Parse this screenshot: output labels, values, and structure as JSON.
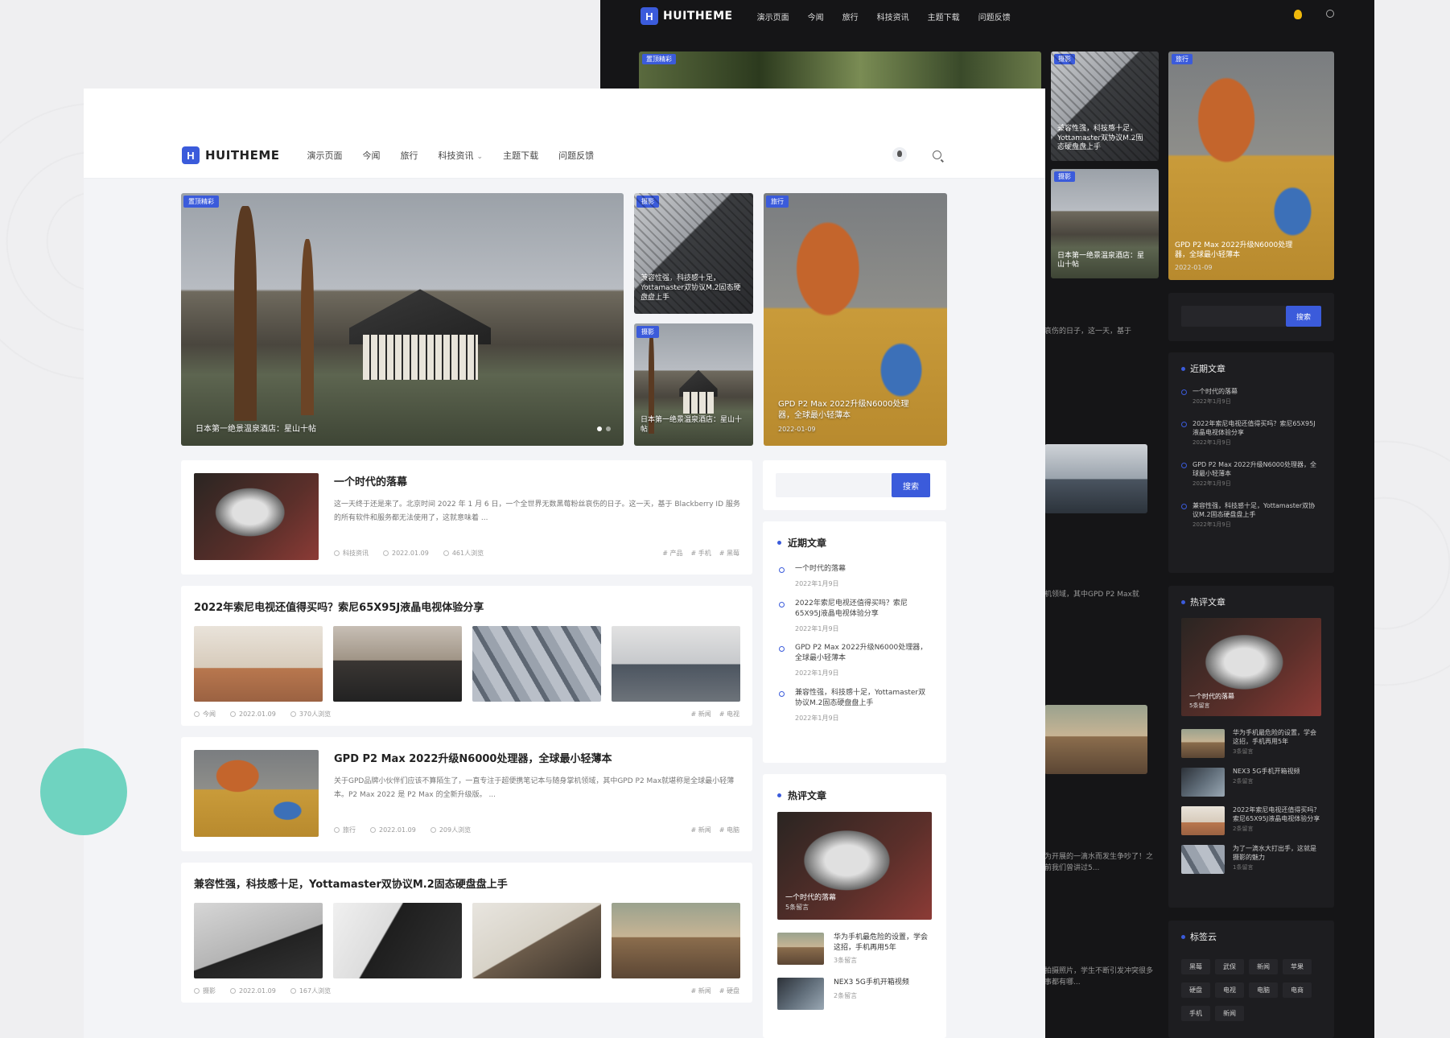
{
  "brand": {
    "name": "HUITHEME",
    "logo_letter": "H",
    "accent": "#3b5bdb"
  },
  "nav": {
    "items": [
      "演示页面",
      "今闻",
      "旅行",
      "科技资讯",
      "主题下载",
      "问题反馈"
    ]
  },
  "hero": {
    "main": {
      "tag": "置顶精彩",
      "caption": "日本第一绝景温泉酒店：星山十帖"
    },
    "small1": {
      "tag": "摄影",
      "caption": "兼容性强，科技感十足，Yottamaster双协议M.2固态硬盘盘上手"
    },
    "small2": {
      "tag": "摄影",
      "caption": "日本第一绝景温泉酒店：星山十帖"
    },
    "tall": {
      "tag": "旅行",
      "caption": "GPD P2 Max 2022升级N6000处理器，全球最小轻薄本",
      "date": "2022-01-09"
    }
  },
  "posts": [
    {
      "title": "一个时代的落幕",
      "excerpt": "这一天终于还是来了。北京时间 2022 年 1 月 6 日，一个全世界无数黑莓粉丝哀伤的日子。这一天，基于 Blackberry ID 服务的所有软件和服务都无法使用了，这就意味着 ...",
      "category": "科技资讯",
      "date": "2022.01.09",
      "views": "461人浏览",
      "tags": [
        "产品",
        "手机",
        "黑莓"
      ]
    },
    {
      "title": "2022年索尼电视还值得买吗？索尼65X95J液晶电视体验分享",
      "category": "今闻",
      "date": "2022.01.09",
      "views": "370人浏览",
      "tags": [
        "新闻",
        "电视"
      ]
    },
    {
      "title": "GPD P2 Max 2022升级N6000处理器，全球最小轻薄本",
      "excerpt": "关于GPD品牌小伙伴们应该不算陌生了，一直专注于超便携笔记本与随身掌机领域，其中GPD P2 Max就堪称是全球最小轻薄本。P2 Max 2022 是 P2 Max 的全新升级版。 ...",
      "category": "旅行",
      "date": "2022.01.09",
      "views": "209人浏览",
      "tags": [
        "新闻",
        "电脑"
      ]
    },
    {
      "title": "兼容性强，科技感十足，Yottamaster双协议M.2固态硬盘盘上手",
      "category": "摄影",
      "date": "2022.01.09",
      "views": "167人浏览",
      "tags": [
        "新闻",
        "硬盘"
      ]
    }
  ],
  "search": {
    "placeholder": "",
    "button": "搜索"
  },
  "recent": {
    "title": "近期文章",
    "items": [
      {
        "title": "一个时代的落幕",
        "date": "2022年1月9日"
      },
      {
        "title": "2022年索尼电视还值得买吗？索尼65X95J液晶电视体验分享",
        "date": "2022年1月9日"
      },
      {
        "title": "GPD P2 Max 2022升级N6000处理器，全球最小轻薄本",
        "date": "2022年1月9日"
      },
      {
        "title": "兼容性强，科技感十足，Yottamaster双协议M.2固态硬盘盘上手",
        "date": "2022年1月9日"
      }
    ]
  },
  "hot": {
    "title": "热评文章",
    "big": {
      "title": "一个时代的落幕",
      "comments": "5条留言"
    },
    "items": [
      {
        "title": "华为手机最危险的设置，学会这招，手机再用5年",
        "comments": "3条留言"
      },
      {
        "title": "NEX3 5G手机开箱视频",
        "comments": "2条留言"
      },
      {
        "title": "2022年索尼电视还值得买吗？索尼65X95J液晶电视体验分享",
        "comments": "2条留言"
      },
      {
        "title": "为了一滴水大打出手，这就是摄影的魅力",
        "comments": "1条留言"
      }
    ]
  },
  "dark": {
    "search_button": "搜索",
    "tag_cloud_title": "标签云",
    "tags": [
      "黑莓",
      "武保",
      "新闻",
      "苹果",
      "硬盘",
      "电视",
      "电脑",
      "电商",
      "手机",
      "新闻"
    ],
    "snippets": [
      "哀伤的日子，这一天，基于",
      "机领域，其中GPD P2 Max就",
      "为开展的一滴水而发生争吵了！之前我们曾讲过5...",
      "拍摄照片，学生不断引发冲突很多事都有哪..."
    ]
  }
}
